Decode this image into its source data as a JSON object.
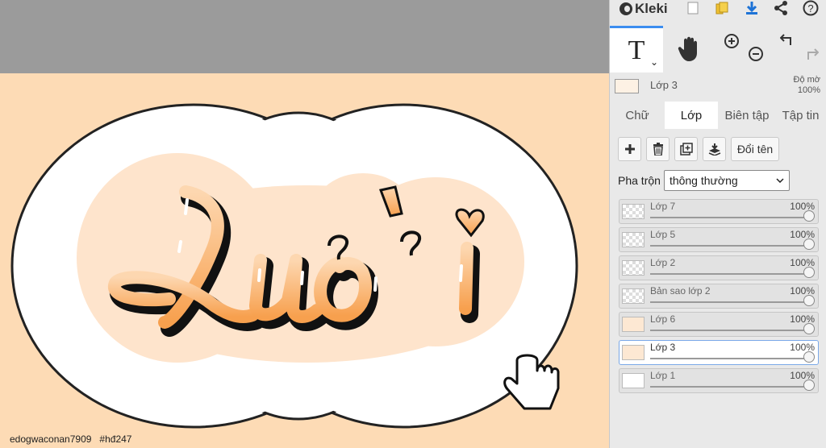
{
  "canvas": {
    "artwork_text": "Lưởi",
    "watermark": "edogwaconan7909   #hđ247",
    "colors": {
      "background": "#fddbb5",
      "cloud": "#ffffff",
      "glow": "#fee4cc",
      "letter_top": "#fdd7b0",
      "letter_bottom": "#f7a04e"
    }
  },
  "app": {
    "name": "Kleki"
  },
  "toolbar": {
    "icons": [
      "new-file-icon",
      "folder-icon",
      "download-icon",
      "share-icon",
      "help-icon"
    ],
    "tools": [
      "text-tool-icon",
      "hand-tool-icon",
      "zoom-in-icon",
      "zoom-out-icon",
      "undo-icon",
      "redo-icon"
    ]
  },
  "current_layer": {
    "name": "Lớp 3",
    "opacity_label": "Độ mờ",
    "opacity_value": "100%"
  },
  "tabs": [
    "Chữ",
    "Lớp",
    "Biên tập",
    "Tập tin"
  ],
  "active_tab": "Lớp",
  "layer_panel": {
    "rename_label": "Đổi tên",
    "blend_label": "Pha trộn",
    "blend_value": "thông thường",
    "layers": [
      {
        "name": "Lớp 7",
        "opacity": "100%"
      },
      {
        "name": "Lớp 5",
        "opacity": "100%"
      },
      {
        "name": "Lớp 2",
        "opacity": "100%"
      },
      {
        "name": "Bản sao lớp 2",
        "opacity": "100%"
      },
      {
        "name": "Lớp 6",
        "opacity": "100%"
      },
      {
        "name": "Lớp 3",
        "opacity": "100%",
        "selected": true
      },
      {
        "name": "Lớp 1",
        "opacity": "100%"
      }
    ]
  }
}
